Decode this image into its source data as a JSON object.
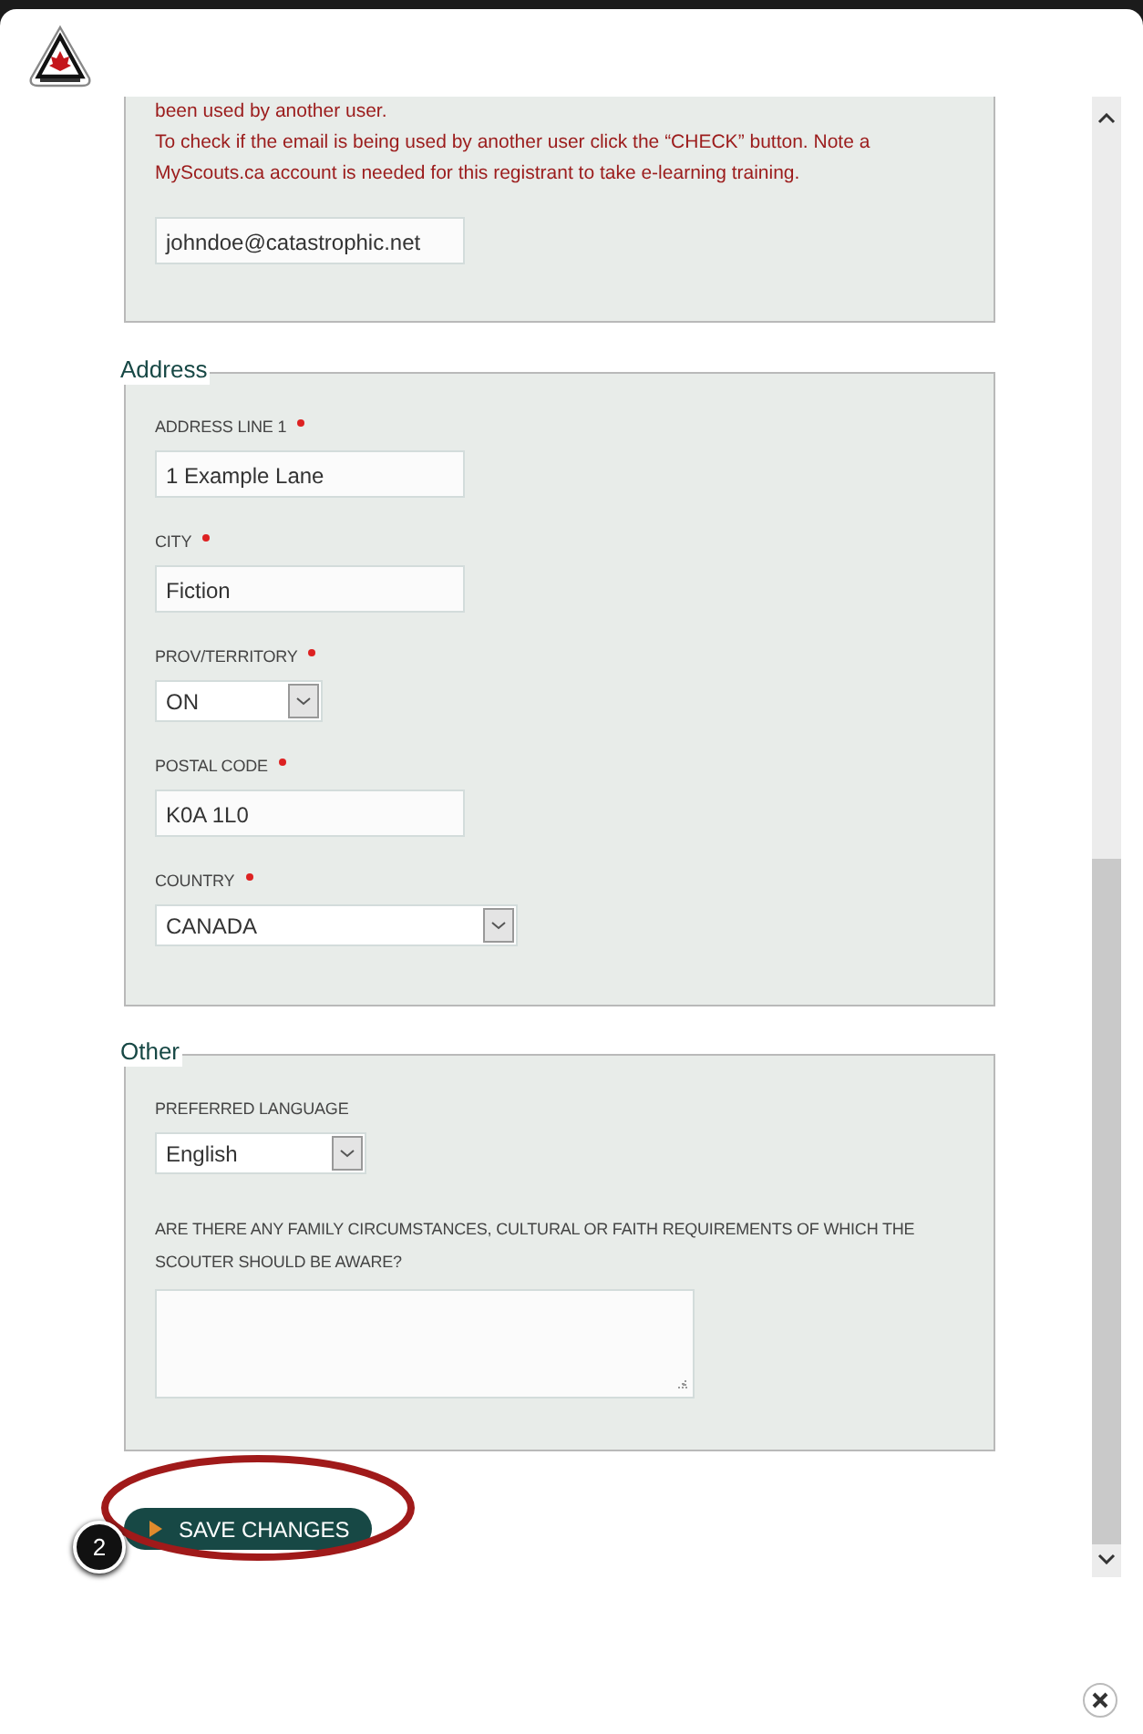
{
  "email_section": {
    "notice_lines": [
      "been used by another user.",
      "To check if the email is being used by another user click the “CHECK” button. Note a MyScouts.ca account is needed for this registrant to take e-learning training."
    ],
    "email_value": "johndoe@catastrophic.net"
  },
  "sections": [
    {
      "legend": "Address",
      "fields": [
        {
          "kind": "text",
          "label": "ADDRESS LINE 1",
          "required": true,
          "value": "1 Example Lane"
        },
        {
          "kind": "text",
          "label": "CITY",
          "required": true,
          "value": "Fiction"
        },
        {
          "kind": "select",
          "label": "PROV/TERRITORY",
          "required": true,
          "value": "ON"
        },
        {
          "kind": "text",
          "label": "POSTAL CODE",
          "required": true,
          "value": "K0A 1L0"
        },
        {
          "kind": "select",
          "label": "COUNTRY",
          "required": true,
          "value": "CANADA"
        }
      ]
    },
    {
      "legend": "Other",
      "fields": [
        {
          "kind": "select",
          "label": "PREFERRED LANGUAGE",
          "required": false,
          "value": "English"
        },
        {
          "kind": "textarea",
          "label": "ARE THERE ANY FAMILY CIRCUMSTANCES, CULTURAL OR FAITH REQUIREMENTS OF WHICH THE SCOUTER SHOULD BE AWARE?",
          "required": false
        }
      ]
    }
  ],
  "save_button": "SAVE CHANGES",
  "annotation": {
    "number": "2"
  }
}
